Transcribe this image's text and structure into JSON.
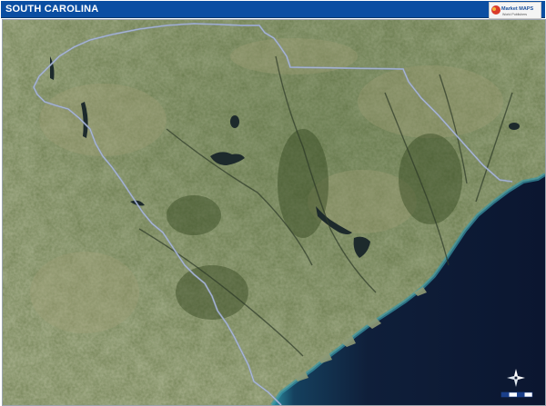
{
  "header": {
    "title": "SOUTH CAROLINA",
    "logo_text_main": "Market MAPS",
    "logo_text_sub": "World Publishers"
  },
  "colors": {
    "header_bg": "#0b4ea2",
    "land": "#6d7d4f",
    "ocean": "#0f1f3a",
    "coast_shallow": "#2c8fa1",
    "border": "#8e9fc8"
  },
  "icons": [
    "compass-rose-icon",
    "scale-bar-icon"
  ]
}
